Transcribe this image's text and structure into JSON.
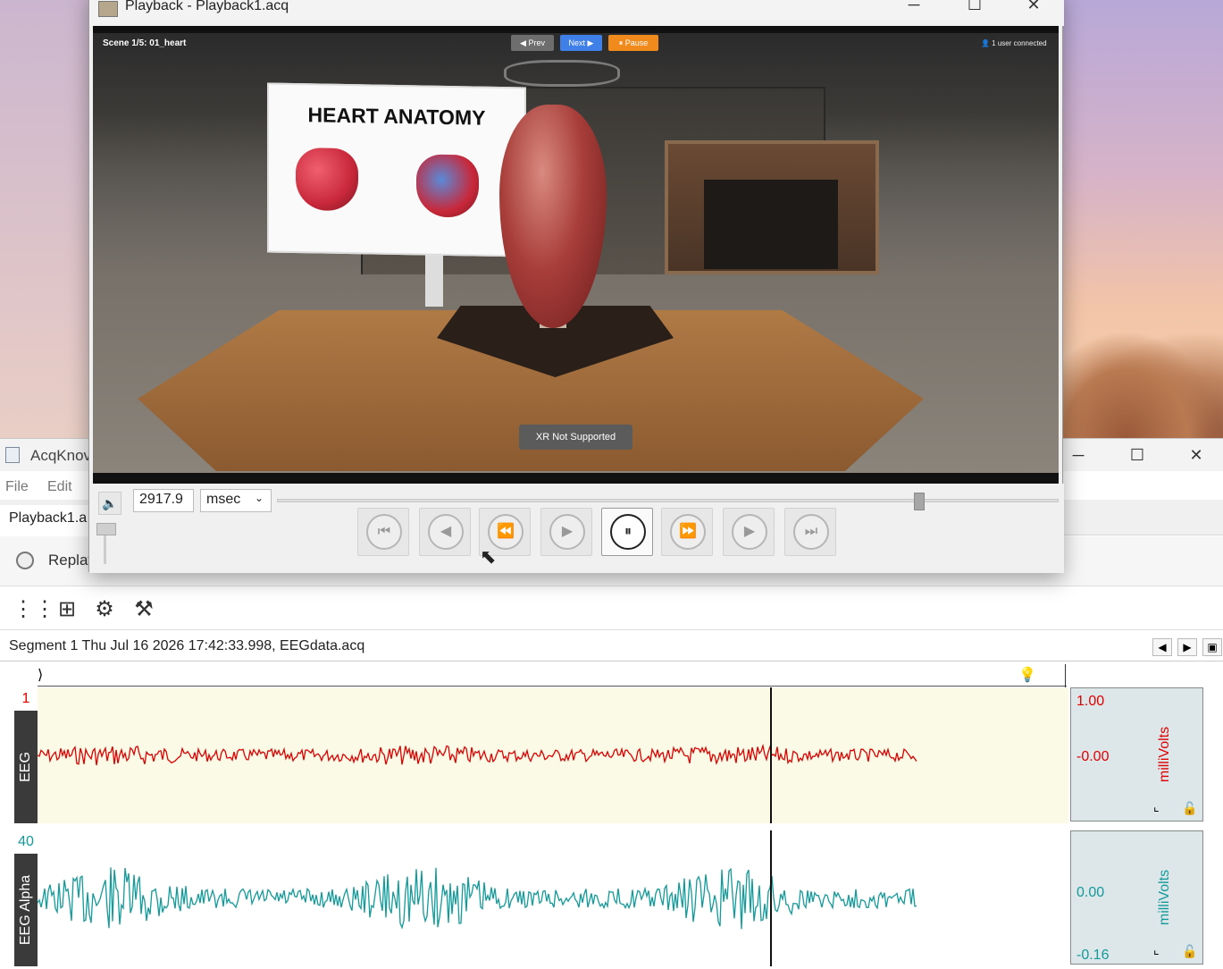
{
  "playback_window": {
    "title": "Playback - Playback1.acq",
    "video": {
      "scene_label": "Scene 1/5: 01_heart",
      "prev_label": "◀ Prev",
      "next_label": "Next ▶",
      "pause_label": "⏸ Pause",
      "users_label": "👤 1 user connected",
      "board_title": "HEART ANATOMY",
      "xr_label": "XR Not Supported"
    },
    "controls": {
      "time_value": "2917.9",
      "unit_value": "msec",
      "seek_fraction": 0.82,
      "buttons": [
        {
          "name": "go-to-start",
          "glyph": "⏮"
        },
        {
          "name": "step-back",
          "glyph": "◀"
        },
        {
          "name": "rewind",
          "glyph": "⏪"
        },
        {
          "name": "play",
          "glyph": "▶"
        },
        {
          "name": "pause",
          "glyph": "⏸"
        },
        {
          "name": "fast-forward",
          "glyph": "⏩"
        },
        {
          "name": "step-forward",
          "glyph": "▶"
        },
        {
          "name": "go-to-end",
          "glyph": "⏭"
        }
      ]
    }
  },
  "main_window": {
    "title": "AcqKnov",
    "menu": {
      "file": "File",
      "edit": "Edit"
    },
    "tab_label": "Playback1.a",
    "replay_label": "Replay",
    "segment_info": "Segment 1 Thu Jul 16 2026 17:42:33.998, EEGdata.acq",
    "channels": [
      {
        "number": "1",
        "label": "EEG",
        "scale_top": "1.00",
        "scale_mid": "-0.00",
        "unit": "milliVolts",
        "color": "#e00000",
        "bg": "#fafae6"
      },
      {
        "number": "40",
        "label": "EEG Alpha",
        "scale_mid": "0.00",
        "scale_bottom": "-0.16",
        "unit": "milliVolts",
        "color": "#139a9a",
        "bg": "#ffffff"
      }
    ]
  },
  "colors": {
    "accent_blue": "#3f7fe8",
    "pause_orange": "#f08a1c"
  }
}
